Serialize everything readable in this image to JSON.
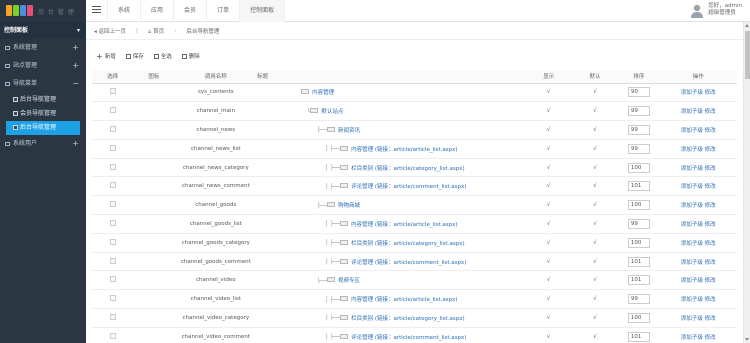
{
  "header": {
    "logo_text": "后 台 管 理",
    "logo_colors": [
      "#f5a623",
      "#7ed321",
      "#4a90e2",
      "#e94e77"
    ],
    "tabs": [
      "系统",
      "应用",
      "会员",
      "订单",
      "控制面板"
    ],
    "active_tab": 4,
    "user_line1": "您好，admin",
    "user_line2": "超级管理员"
  },
  "sidebar": {
    "title": "控制面板",
    "items": [
      {
        "label": "系统管理",
        "icon": "folder-icon"
      },
      {
        "label": "站点管理",
        "icon": "folder-icon"
      },
      {
        "label": "导航菜单",
        "icon": "folder-icon"
      }
    ],
    "subitems": [
      {
        "label": "后台导航管理"
      },
      {
        "label": "会员导航管理"
      },
      {
        "label": "后台导航管理"
      }
    ],
    "last_item": {
      "label": "系统用户",
      "icon": "folder-icon"
    }
  },
  "breadcrumb": {
    "back": "返回上一页",
    "home": "首页",
    "current": "后台导航管理"
  },
  "toolbar": {
    "add": "新增",
    "save": "保存",
    "select_all": "全选",
    "delete": "删除"
  },
  "table": {
    "headers": [
      "选择",
      "图标",
      "调用名称",
      "标题",
      "显示",
      "默认",
      "排序",
      "操作"
    ],
    "rows": [
      {
        "name": "sys_contents",
        "title": "内容管理",
        "depth": 0,
        "show": "√",
        "def": "√",
        "sort": "90",
        "action": "添加子级 修改"
      },
      {
        "name": "channel_main",
        "title": "默认站点",
        "depth": 1,
        "show": "√",
        "def": "√",
        "sort": "99",
        "action": "添加子级 修改"
      },
      {
        "name": "channel_news",
        "title": "新闻资讯",
        "depth": 2,
        "show": "√",
        "def": "√",
        "sort": "99",
        "action": "添加子级 修改"
      },
      {
        "name": "channel_news_list",
        "title": "内容管理 (链接：article/article_list.aspx)",
        "depth": 3,
        "show": "√",
        "def": "√",
        "sort": "99",
        "action": "添加子级 修改"
      },
      {
        "name": "channel_news_category",
        "title": "栏目类别 (链接：article/category_list.aspx)",
        "depth": 3,
        "show": "√",
        "def": "√",
        "sort": "100",
        "action": "添加子级 修改"
      },
      {
        "name": "channel_news_comment",
        "title": "评论管理 (链接：article/comment_list.aspx)",
        "depth": 3,
        "show": "√",
        "def": "√",
        "sort": "101",
        "action": "添加子级 修改"
      },
      {
        "name": "channel_goods",
        "title": "购物商城",
        "depth": 2,
        "show": "√",
        "def": "√",
        "sort": "100",
        "action": "添加子级 修改"
      },
      {
        "name": "channel_goods_list",
        "title": "内容管理 (链接：article/article_list.aspx)",
        "depth": 3,
        "show": "√",
        "def": "√",
        "sort": "99",
        "action": "添加子级 修改"
      },
      {
        "name": "channel_goods_category",
        "title": "栏目类别 (链接：article/category_list.aspx)",
        "depth": 3,
        "show": "√",
        "def": "√",
        "sort": "100",
        "action": "添加子级 修改"
      },
      {
        "name": "channel_goods_comment",
        "title": "评论管理 (链接：article/comment_list.aspx)",
        "depth": 3,
        "show": "√",
        "def": "√",
        "sort": "101",
        "action": "添加子级 修改"
      },
      {
        "name": "channel_video",
        "title": "视频专区",
        "depth": 2,
        "show": "√",
        "def": "√",
        "sort": "101",
        "action": "添加子级 修改"
      },
      {
        "name": "channel_video_list",
        "title": "内容管理 (链接：article/article_list.aspx)",
        "depth": 3,
        "show": "√",
        "def": "√",
        "sort": "99",
        "action": "添加子级 修改"
      },
      {
        "name": "channel_video_category",
        "title": "栏目类别 (链接：article/category_list.aspx)",
        "depth": 3,
        "show": "√",
        "def": "√",
        "sort": "100",
        "action": "添加子级 修改"
      },
      {
        "name": "channel_video_comment",
        "title": "评论管理 (链接：article/comment_list.aspx)",
        "depth": 3,
        "show": "√",
        "def": "√",
        "sort": "101",
        "action": "添加子级 修改"
      }
    ]
  }
}
